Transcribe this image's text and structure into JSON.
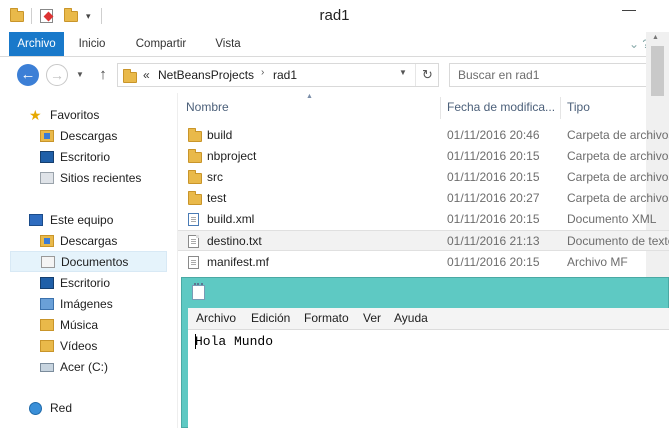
{
  "window": {
    "title": "rad1",
    "minimize_glyph": "—"
  },
  "ribbon": {
    "tabs": [
      {
        "label": "Archivo",
        "active": true
      },
      {
        "label": "Inicio"
      },
      {
        "label": "Compartir"
      },
      {
        "label": "Vista"
      }
    ],
    "expand_glyph": "⌄  ?"
  },
  "nav": {
    "back_glyph": "←",
    "forward_glyph": "→",
    "recent_glyph": "▼",
    "up_glyph": "↑",
    "address": {
      "overflow_glyph": "«",
      "crumbs": [
        "NetBeansProjects",
        "rad1"
      ],
      "separator_glyph": "›",
      "dropdown_glyph": "▼",
      "refresh_glyph": "↻"
    },
    "search_placeholder": "Buscar en rad1"
  },
  "sidebar": {
    "favorites": {
      "label": "Favoritos",
      "items": [
        {
          "label": "Descargas",
          "icon": "downloads-icon"
        },
        {
          "label": "Escritorio",
          "icon": "desktop-icon"
        },
        {
          "label": "Sitios recientes",
          "icon": "recent-places-icon"
        }
      ]
    },
    "thispc": {
      "label": "Este equipo",
      "items": [
        {
          "label": "Descargas",
          "icon": "downloads-icon"
        },
        {
          "label": "Documentos",
          "icon": "documents-icon",
          "selected": true
        },
        {
          "label": "Escritorio",
          "icon": "desktop-icon"
        },
        {
          "label": "Imágenes",
          "icon": "pictures-icon"
        },
        {
          "label": "Música",
          "icon": "music-icon"
        },
        {
          "label": "Vídeos",
          "icon": "videos-icon"
        },
        {
          "label": "Acer (C:)",
          "icon": "drive-icon"
        }
      ]
    },
    "network": {
      "label": "Red"
    }
  },
  "files": {
    "columns": {
      "name": "Nombre",
      "date": "Fecha de modifica...",
      "type": "Tipo"
    },
    "sort_glyph": "▲",
    "rows": [
      {
        "name": "build",
        "date": "01/11/2016 20:46",
        "type": "Carpeta de archivos",
        "icon": "folder-icon"
      },
      {
        "name": "nbproject",
        "date": "01/11/2016 20:15",
        "type": "Carpeta de archivos",
        "icon": "folder-icon"
      },
      {
        "name": "src",
        "date": "01/11/2016 20:15",
        "type": "Carpeta de archivos",
        "icon": "folder-icon"
      },
      {
        "name": "test",
        "date": "01/11/2016 20:27",
        "type": "Carpeta de archivos",
        "icon": "folder-icon"
      },
      {
        "name": "build.xml",
        "date": "01/11/2016 20:15",
        "type": "Documento XML",
        "icon": "xml-file-icon"
      },
      {
        "name": "destino.txt",
        "date": "01/11/2016 21:13",
        "type": "Documento de texto",
        "icon": "text-file-icon",
        "selected": true
      },
      {
        "name": "manifest.mf",
        "date": "01/11/2016 20:15",
        "type": "Archivo MF",
        "icon": "file-icon"
      }
    ]
  },
  "notepad": {
    "menu": [
      "Archivo",
      "Edición",
      "Formato",
      "Ver",
      "Ayuda"
    ],
    "content": "Hola Mundo"
  },
  "colors": {
    "accent": "#1979ca",
    "notepad_frame": "#5ec9c3",
    "selection": "#e5f3fb"
  }
}
